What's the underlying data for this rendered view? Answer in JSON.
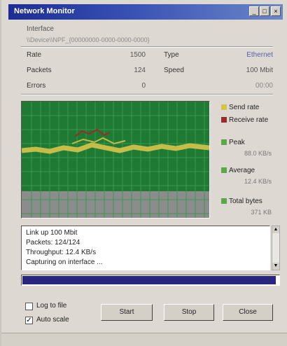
{
  "window": {
    "title": "Network Monitor"
  },
  "titlebar_buttons": {
    "minimize": "_",
    "maximize": "□",
    "close": "×"
  },
  "details": {
    "section_label": "Interface",
    "path_hint": "\\\\Device\\\\NPF_{00000000-0000-0000-0000}",
    "rows": [
      {
        "label": "Rate",
        "value": "1500",
        "label2": "Type",
        "value2": "Ethernet"
      },
      {
        "label": "Packets",
        "value": "124",
        "label2": "Speed",
        "value2": "100 Mbit"
      },
      {
        "label": "Errors",
        "value": "0",
        "label2": "",
        "value2": "00:00"
      }
    ]
  },
  "legend": [
    {
      "label": "Send rate",
      "color": "#d8c34a",
      "value": ""
    },
    {
      "label": "Receive rate",
      "color": "#9b2b2b",
      "value": ""
    },
    {
      "label": "Peak",
      "color": "#5aa848",
      "value": "88.0 KB/s"
    },
    {
      "label": "Average",
      "color": "#5aa848",
      "value": "12.4 KB/s"
    },
    {
      "label": "Total bytes",
      "color": "#5aa848",
      "value": "371 KB"
    }
  ],
  "log": {
    "lines": [
      "Link up 100 Mbit",
      "Packets: 124/124",
      "Throughput: 12.4 KB/s",
      "Capturing on interface ..."
    ]
  },
  "progress": {
    "fraction": 0.99
  },
  "options": {
    "checkboxes": [
      {
        "label": "Log to file",
        "checked": false
      },
      {
        "label": "Auto scale",
        "checked": true
      }
    ]
  },
  "buttons": {
    "start": "Start",
    "stop": "Stop",
    "close": "Close"
  },
  "colors": {
    "graph_bg": "#1f7a34",
    "grid": "#3a9a4c",
    "send": "#d8c34a",
    "receive": "#9b2b2b",
    "progress": "#2a2680"
  }
}
